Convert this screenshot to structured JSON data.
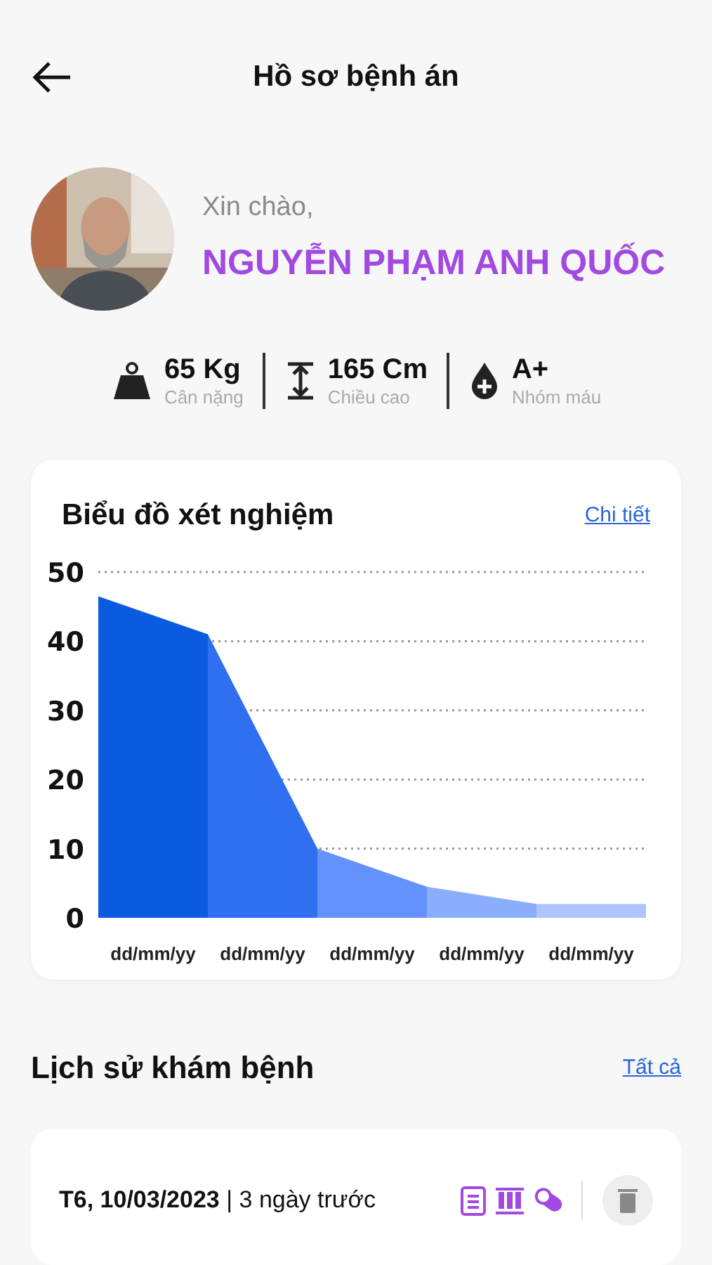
{
  "header": {
    "title": "Hồ sơ bệnh án"
  },
  "profile": {
    "greeting": "Xin chào,",
    "name": "NGUYỄN PHẠM ANH QUỐC"
  },
  "stats": [
    {
      "kind": "weight",
      "value": "65 Kg",
      "label": "Cân nặng"
    },
    {
      "kind": "height",
      "value": "165 Cm",
      "label": "Chiều cao"
    },
    {
      "kind": "blood",
      "value": "A+",
      "label": "Nhóm máu"
    }
  ],
  "chart_card": {
    "title": "Biểu đồ xét nghiệm",
    "link": "Chi tiết",
    "chart_data": {
      "type": "area",
      "grid": true,
      "categories": [
        null,
        "dd/mm/yy",
        null,
        "dd/mm/yy",
        null,
        "dd/mm/yy",
        null,
        "dd/mm/yy",
        null,
        "dd/mm/yy",
        null
      ],
      "series": [
        {
          "color": "#0a5be0",
          "values": [
            46.5,
            43.75,
            41,
            null,
            null,
            null,
            null,
            null,
            null,
            null,
            null
          ]
        },
        {
          "color": "#2f6ff0",
          "values": [
            null,
            null,
            41,
            25.5,
            10,
            null,
            null,
            null,
            null,
            null,
            null
          ]
        },
        {
          "color": "#6591fa",
          "values": [
            null,
            null,
            null,
            null,
            10,
            7.25,
            4.5,
            null,
            null,
            null,
            null
          ]
        },
        {
          "color": "#8aaefc",
          "values": [
            null,
            null,
            null,
            null,
            null,
            null,
            4.5,
            3.25,
            2,
            null,
            null
          ]
        },
        {
          "color": "#adc6fd",
          "values": [
            null,
            null,
            null,
            null,
            null,
            null,
            null,
            null,
            2,
            2,
            2
          ]
        }
      ],
      "ylim": [
        0,
        50
      ],
      "yticks": [
        0,
        10,
        20,
        30,
        40,
        50
      ]
    }
  },
  "history": {
    "title": "Lịch sử khám bệnh",
    "link": "Tất cả",
    "visits": [
      {
        "date": "T6, 10/03/2023",
        "separator": "|",
        "ago": "3 ngày trước"
      }
    ]
  }
}
